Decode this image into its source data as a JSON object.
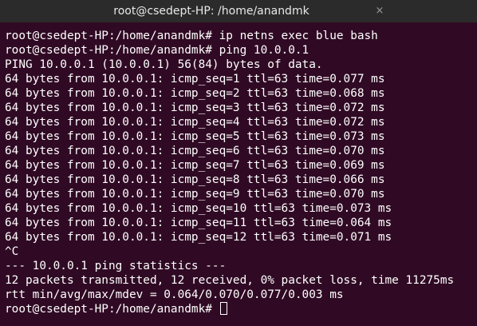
{
  "window": {
    "title": "root@csedept-HP: /home/anandmk",
    "close_icon": "×"
  },
  "terminal": {
    "lines": [
      "root@csedept-HP:/home/anandmk# ip netns exec blue bash",
      "root@csedept-HP:/home/anandmk# ping 10.0.0.1",
      "PING 10.0.0.1 (10.0.0.1) 56(84) bytes of data.",
      "64 bytes from 10.0.0.1: icmp_seq=1 ttl=63 time=0.077 ms",
      "64 bytes from 10.0.0.1: icmp_seq=2 ttl=63 time=0.068 ms",
      "64 bytes from 10.0.0.1: icmp_seq=3 ttl=63 time=0.072 ms",
      "64 bytes from 10.0.0.1: icmp_seq=4 ttl=63 time=0.072 ms",
      "64 bytes from 10.0.0.1: icmp_seq=5 ttl=63 time=0.073 ms",
      "64 bytes from 10.0.0.1: icmp_seq=6 ttl=63 time=0.070 ms",
      "64 bytes from 10.0.0.1: icmp_seq=7 ttl=63 time=0.069 ms",
      "64 bytes from 10.0.0.1: icmp_seq=8 ttl=63 time=0.066 ms",
      "64 bytes from 10.0.0.1: icmp_seq=9 ttl=63 time=0.070 ms",
      "64 bytes from 10.0.0.1: icmp_seq=10 ttl=63 time=0.073 ms",
      "64 bytes from 10.0.0.1: icmp_seq=11 ttl=63 time=0.064 ms",
      "64 bytes from 10.0.0.1: icmp_seq=12 ttl=63 time=0.071 ms",
      "^C",
      "--- 10.0.0.1 ping statistics ---",
      "12 packets transmitted, 12 received, 0% packet loss, time 11275ms",
      "rtt min/avg/max/mdev = 0.064/0.070/0.077/0.003 ms"
    ],
    "prompt": "root@csedept-HP:/home/anandmk# "
  },
  "colors": {
    "background": "#300a24",
    "titlebar": "#2b2b2b",
    "text": "#ffffff"
  }
}
